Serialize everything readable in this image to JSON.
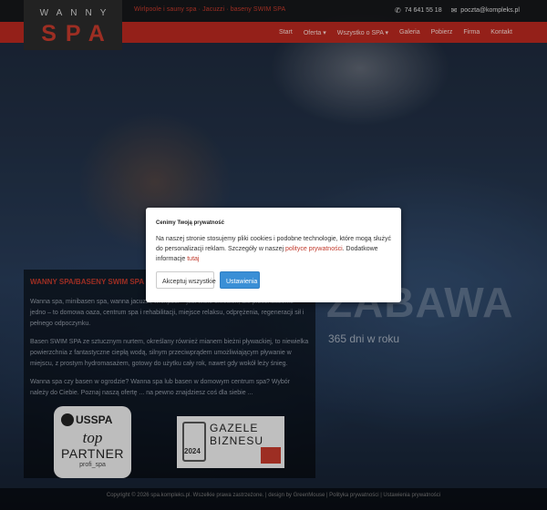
{
  "logo": {
    "line1": "WANNY",
    "line2": "SPA"
  },
  "topbar": {
    "tagline": "Wirlpoole i sauny spa · Jacuzzi · baseny SWIM SPA",
    "phone": "74 641 55 18",
    "email": "poczta@kompleks.pl"
  },
  "nav": {
    "items": [
      "Start",
      "Oferta ▾",
      "Wszystko o SPA ▾",
      "Galeria",
      "Pobierz",
      "Firma",
      "Kontakt"
    ]
  },
  "hero": {
    "title": "ZABAWA",
    "subtitle": "365 dni w roku"
  },
  "panel": {
    "title": "WANNY SPA/BASENY SWIM SPA",
    "p1": "Wanna spa, minibasen spa, wanna jacuzzi, whirlpool – jest wiele określeń, ale przeznaczenie jedno – to domowa oaza, centrum spa i rehabilitacji, miejsce relaksu, odprężenia, regeneracji sił i pełnego odpoczynku.",
    "p2": "Basen SWIM SPA ze sztucznym nurtem, określany również mianem bieżni pływackiej, to niewielka powierzchnia z fantastyczne ciepłą wodą, silnym przeciwprądem umożliwiającym pływanie w miejscu, z prostym hydromasażem, gotowy do użytku cały rok, nawet gdy wokół leży śnieg.",
    "p3": "Wanna spa czy basen w ogrodzie? Wanna spa lub basen w domowym centrum spa? Wybór należy do Ciebie. Poznaj naszą ofertę ... na pewno znajdziesz coś dla siebie ..."
  },
  "badges": {
    "usspa": {
      "brand": "USSPA",
      "line1": "top",
      "line2": "PARTNER",
      "line3": "profi_spa"
    },
    "gazele": {
      "line1": "GAZELE",
      "line2": "BIZNESU",
      "year": "2024"
    }
  },
  "footer": {
    "text": "Copyright © 2026 spa.kompleks.pl. Wszelkie prawa zastrzeżone. | design by GreenMouse | Polityka prywatności | Ustawienia prywatności"
  },
  "modal": {
    "title": "Cenimy Twoją prywatność",
    "body_part1": "Na naszej stronie stosujemy pliki cookies i podobne technologie, które mogą służyć do personalizacji reklam. Szczegóły w naszej ",
    "link1": "polityce prywatności",
    "body_part2": ". Dodatkowe informacje ",
    "link2": "tutaj",
    "accept": "Akceptuj wszystkie",
    "settings": "Ustawienia"
  },
  "colors": {
    "accent": "#b5281f",
    "button_blue": "#3a8fd6"
  },
  "icons": {
    "phone": "phone-icon",
    "email": "envelope-icon"
  }
}
